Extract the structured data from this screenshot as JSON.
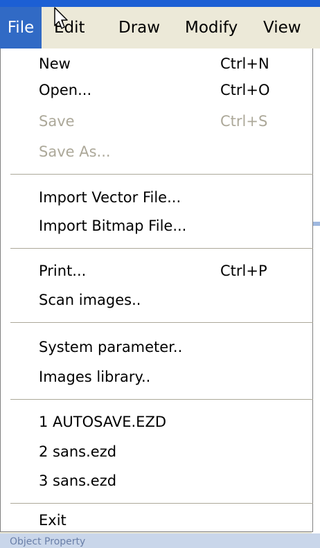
{
  "menubar": {
    "items": [
      "File",
      "Edit",
      "Draw",
      "Modify",
      "View"
    ]
  },
  "file_menu": {
    "new_label": "New",
    "new_shortcut": "Ctrl+N",
    "open_label": "Open...",
    "open_shortcut": "Ctrl+O",
    "save_label": "Save",
    "save_shortcut": "Ctrl+S",
    "save_as_label": "Save As...",
    "import_vector_label": "Import Vector File...",
    "import_bitmap_label": "Import Bitmap File...",
    "print_label": "Print...",
    "print_shortcut": "Ctrl+P",
    "scan_label": "Scan images..",
    "system_param_label": "System parameter..",
    "images_library_label": "Images library..",
    "recent_1": "1 AUTOSAVE.EZD",
    "recent_2": "2 sans.ezd",
    "recent_3": "3 sans.ezd",
    "exit_label": "Exit"
  },
  "background": {
    "bottom_text": "Object Property"
  },
  "colors": {
    "menu_highlight": "#316ac5",
    "disabled_text": "#aca899",
    "menubar_bg": "#ece9d8"
  }
}
